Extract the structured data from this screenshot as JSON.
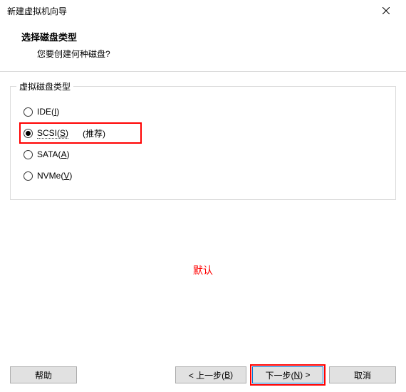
{
  "window": {
    "title": "新建虚拟机向导"
  },
  "header": {
    "title": "选择磁盘类型",
    "subtitle": "您要创建何种磁盘?"
  },
  "group": {
    "label": "虚拟磁盘类型",
    "options": {
      "ide": {
        "label": "IDE(",
        "accel": "I",
        "suffix": ")"
      },
      "scsi": {
        "label": "SCSI(",
        "accel": "S",
        "suffix": ")",
        "rec": "(推荐)"
      },
      "sata": {
        "label": "SATA(",
        "accel": "A",
        "suffix": ")"
      },
      "nvme": {
        "label": "NVMe(",
        "accel": "V",
        "suffix": ")"
      }
    }
  },
  "note": "默认",
  "buttons": {
    "help": "帮助",
    "back_prefix": "< 上一步(",
    "back_accel": "B",
    "back_suffix": ")",
    "next_prefix": "下一步(",
    "next_accel": "N",
    "next_suffix": ") >",
    "cancel": "取消"
  }
}
